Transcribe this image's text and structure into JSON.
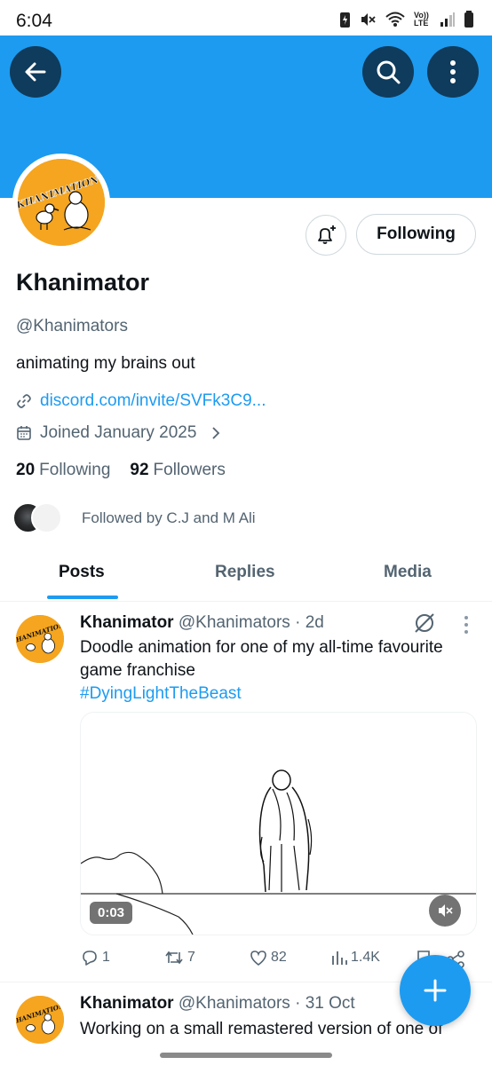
{
  "status_bar": {
    "time": "6:04",
    "network": "Vo)) LTE"
  },
  "profile": {
    "name": "Khanimator",
    "handle": "@Khanimators",
    "bio": "animating my brains out",
    "link": "discord.com/invite/SVFk3C9...",
    "joined": "Joined January 2025",
    "following_count": "20",
    "following_label": "Following",
    "followers_count": "92",
    "followers_label": "Followers",
    "followed_by": "Followed by C.J and M Ali",
    "follow_button": "Following",
    "avatar_text": "KHANIMATIONS"
  },
  "tabs": [
    {
      "label": "Posts"
    },
    {
      "label": "Replies"
    },
    {
      "label": "Media"
    }
  ],
  "posts": [
    {
      "author": "Khanimator",
      "meta": "@Khanimators · 2d",
      "text": "Doodle animation for one of my all-time favourite game franchise",
      "hashtag": "#DyingLightTheBeast",
      "video_time": "0:03",
      "replies": "1",
      "reposts": "7",
      "likes": "82",
      "views": "1.4K"
    },
    {
      "author": "Khanimator",
      "meta": "@Khanimators · 31 Oct",
      "text": "Working on a small remastered version of one of"
    }
  ],
  "colors": {
    "accent": "#1d9bf0",
    "banner": "#1d9bf0",
    "icon_button": "#0f3b5c",
    "avatar_bg": "#f5a51f"
  },
  "icons": [
    "back-arrow-icon",
    "search-icon",
    "more-vertical-icon",
    "bell-plus-icon",
    "link-icon",
    "calendar-icon",
    "chevron-right-icon",
    "grok-icon",
    "reply-icon",
    "repost-icon",
    "like-icon",
    "views-icon",
    "bookmark-icon",
    "share-icon",
    "mute-icon",
    "plus-icon"
  ]
}
